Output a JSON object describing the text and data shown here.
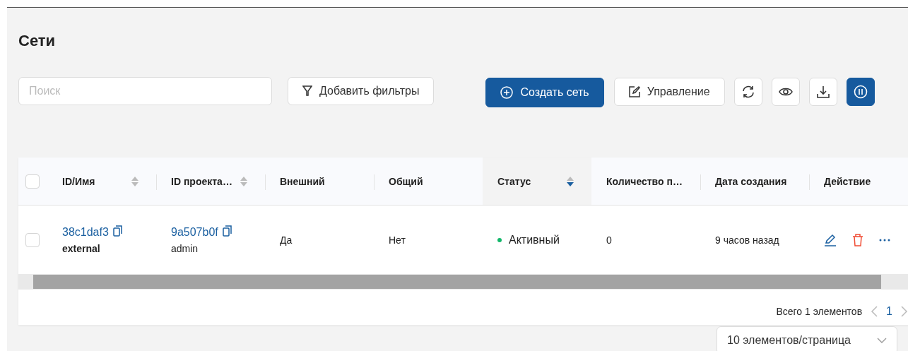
{
  "page": {
    "title": "Сети"
  },
  "toolbar": {
    "search": {
      "placeholder": "Поиск"
    },
    "filter_button": "Добавить фильтры",
    "create_button": "Создать сеть",
    "manage_button": "Управление"
  },
  "table": {
    "select_all_checked": false,
    "columns": [
      {
        "label": "ID/Имя",
        "sortable": true,
        "sort_descending": false
      },
      {
        "label": "ID проекта…",
        "sortable": true,
        "sort_descending": false
      },
      {
        "label": "Внешний"
      },
      {
        "label": "Общий"
      },
      {
        "label": "Статус",
        "sortable": true,
        "sort_descending": true
      },
      {
        "label": "Количество п…"
      },
      {
        "label": "Дата создания"
      },
      {
        "label": "Действие"
      }
    ],
    "rows": [
      {
        "checked": false,
        "id": "38c1daf3",
        "name": "external",
        "project_id": "9a507b0f",
        "project_name": "admin",
        "external": "Да",
        "shared": "Нет",
        "status": {
          "label": "Активный",
          "color": "#12b76a"
        },
        "count": "0",
        "created": "9 часов назад"
      }
    ]
  },
  "pagination": {
    "total": "Всего 1 элементов",
    "pages": [
      {
        "label": "1",
        "selected": true
      }
    ],
    "page_size": "10 элементов/страница"
  }
}
